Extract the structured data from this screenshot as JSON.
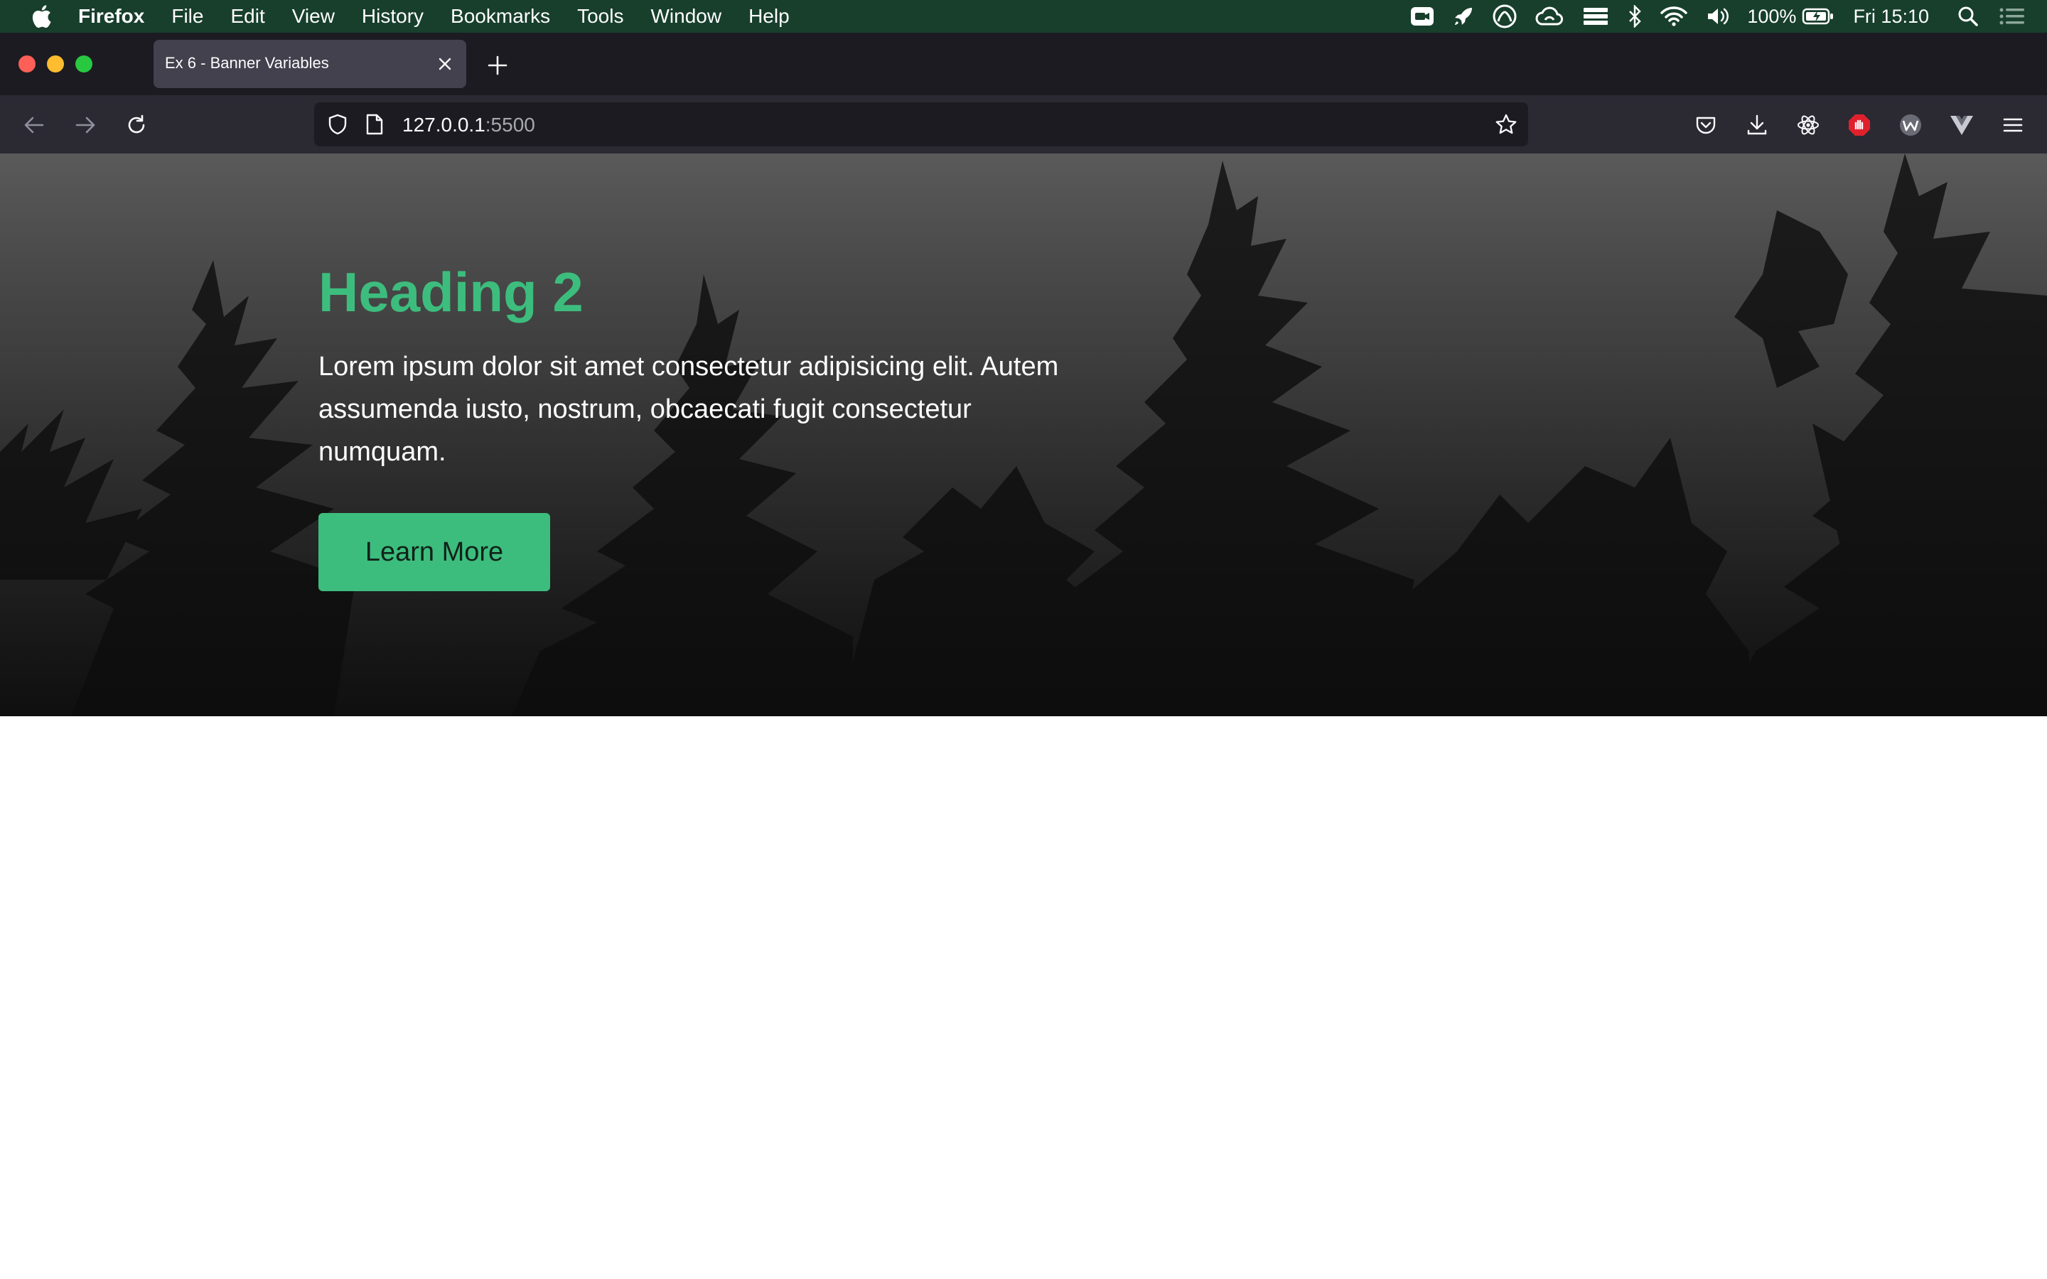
{
  "menubar": {
    "app_name": "Firefox",
    "items": [
      "File",
      "Edit",
      "View",
      "History",
      "Bookmarks",
      "Tools",
      "Window",
      "Help"
    ],
    "battery": "100%",
    "clock": "Fri 15:10",
    "status_icons": [
      "zoom-icon",
      "rocket-icon",
      "creative-cloud-icon",
      "creative-cloud-sync-icon",
      "stack-icon",
      "bluetooth-icon",
      "wifi-icon",
      "volume-icon",
      "battery-icon",
      "spotlight-icon",
      "control-center-icon"
    ]
  },
  "tabs": [
    {
      "title": "Ex 6 - Banner Variables",
      "active": true
    }
  ],
  "urlbar": {
    "host": "127.0.0.1",
    "port": ":5500"
  },
  "toolbar_icons": [
    "pocket-icon",
    "download-icon",
    "react-devtools-icon",
    "adblock-icon",
    "wappalyzer-icon",
    "vue-devtools-icon",
    "menu-icon"
  ],
  "banner": {
    "heading": "Heading 2",
    "paragraph": "Lorem ipsum dolor sit amet consectetur adipisicing elit. Autem assumenda iusto, nostrum, obcaecati fugit consectetur numquam.",
    "button_label": "Learn More"
  },
  "colors": {
    "accent": "#3dbd7d",
    "menubar_bg": "#173f2c",
    "tabstrip_bg": "#1c1b22",
    "navbar_bg": "#2b2a33"
  }
}
